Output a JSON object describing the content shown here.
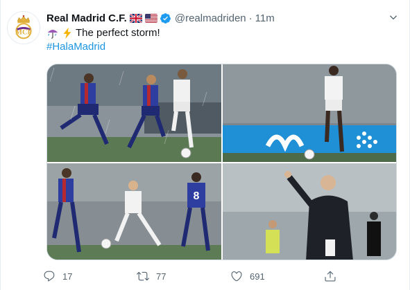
{
  "tweet": {
    "display_name": "Real Madrid C.F.",
    "flags": [
      "uk-flag-icon",
      "us-flag-icon"
    ],
    "verified": true,
    "handle": "@realmadriden",
    "separator": "·",
    "time": "11m",
    "text_line_1": "The perfect storm!",
    "emojis": [
      "umbrella-rain-icon",
      "lightning-icon"
    ],
    "hashtag": "#HalaMadrid",
    "media_count": 4
  },
  "actions": {
    "reply_count": "17",
    "retweet_count": "77",
    "like_count": "691",
    "share_label": ""
  },
  "colors": {
    "text": "#0f1419",
    "secondary": "#536471",
    "link": "#1b95e0",
    "verified": "#1d9bf0",
    "border": "#cfd9de"
  }
}
